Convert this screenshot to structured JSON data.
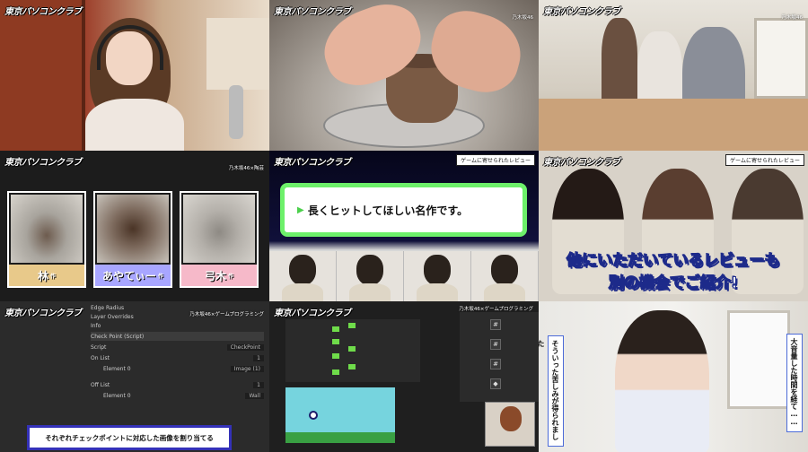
{
  "logo": "東京パソコンクラブ",
  "tiles": {
    "t1_caption": "乃木坂46",
    "t2_caption": "乃木坂46",
    "t3_caption": "乃木坂46×陶芸",
    "t3_works": [
      {
        "name": "林",
        "suffix": "作"
      },
      {
        "name": "あやてぃー",
        "suffix": "作"
      },
      {
        "name": "弓木",
        "suffix": "作"
      }
    ],
    "t4_caption": "ゲームに寄せられたレビュー",
    "t4_review": "長くヒットしてほしい名作です。",
    "t5_caption": "ゲームに寄せられたレビュー",
    "t5_line1": "他にいただいているレビューも",
    "t5_line2": "別の機会でご紹介!",
    "t6_caption": "乃木坂46×ゲームプログラミング",
    "t6_subtitle": "それぞれチェックポイントに対応した画像を割り当てる",
    "t6_inspector": {
      "edge_radius": "Edge Radius",
      "layer_overrides": "Layer Overrides",
      "info": "Info",
      "component": "Check Point (Script)",
      "script_label": "Script",
      "script_value": "CheckPoint",
      "on_list": "On List",
      "off_list": "Off List",
      "element": "Element 0",
      "on_value": "Image (1)",
      "off_value": "Wall",
      "count": "1"
    },
    "t7_caption": "乃木坂46×ゲームプログラミング",
    "t8_vertical1": "そういった苦しみが得られました",
    "t8_vertical2": "大音量した時間を経て……"
  },
  "colors": {
    "review_border": "#6df06a",
    "subtitle_border": "#3431b8",
    "big_stroke": "#1d2a8a"
  }
}
